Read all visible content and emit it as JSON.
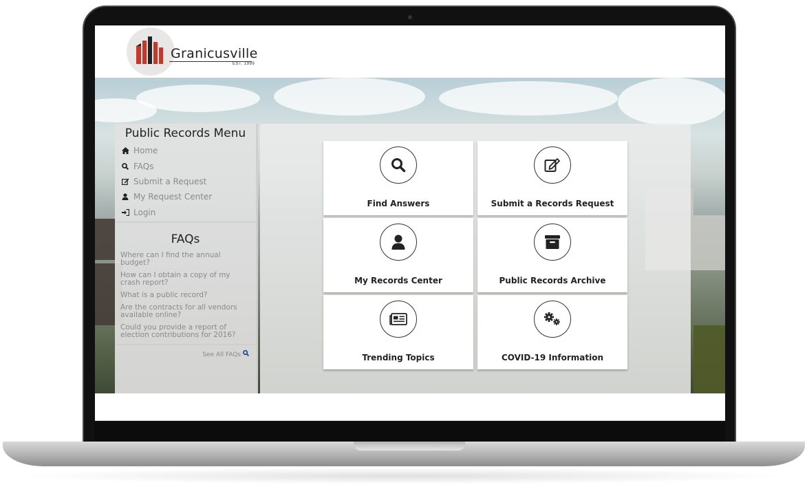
{
  "brand": {
    "name": "Granicusville",
    "est": "EST. 1999"
  },
  "sidebar": {
    "menu_title": "Public Records Menu",
    "menu_items": [
      {
        "label": "Home",
        "icon": "home-icon"
      },
      {
        "label": "FAQs",
        "icon": "search-icon"
      },
      {
        "label": "Submit a Request",
        "icon": "edit-icon"
      },
      {
        "label": "My Request Center",
        "icon": "user-icon"
      },
      {
        "label": "Login",
        "icon": "sign-in-icon"
      }
    ],
    "faq_title": "FAQs",
    "faqs": [
      "Where can I find the annual budget?",
      "How can I obtain a copy of my crash report?",
      "What is a public record?",
      "Are the contracts for all vendors available online?",
      "Could you provide a report of election contributions for 2016?"
    ],
    "see_all_label": "See All FAQs"
  },
  "tiles": [
    {
      "label": "Find Answers",
      "icon": "search-icon"
    },
    {
      "label": "Submit a Records Request",
      "icon": "edit-icon"
    },
    {
      "label": "My Records Center",
      "icon": "user-icon"
    },
    {
      "label": "Public Records Archive",
      "icon": "archive-icon"
    },
    {
      "label": "Trending Topics",
      "icon": "newspaper-icon"
    },
    {
      "label": "COVID-19 Information",
      "icon": "cogs-icon"
    }
  ],
  "colors": {
    "logo_red": "#c0392b",
    "link_blue": "#1a4fa0",
    "text_dark": "#222222",
    "text_muted": "#8a8a8a"
  }
}
